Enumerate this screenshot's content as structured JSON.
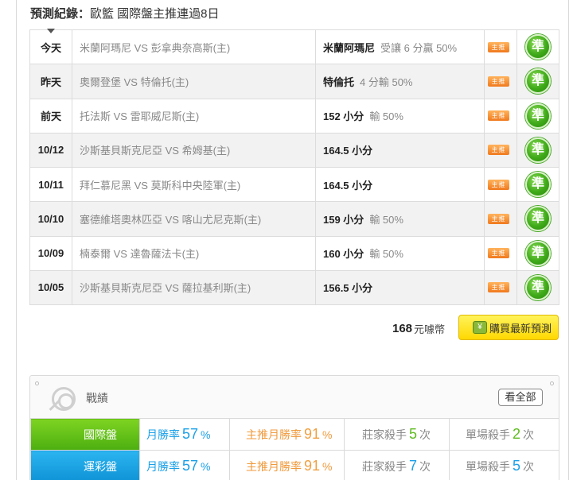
{
  "header": {
    "label": "預測紀錄：",
    "text": "歐籃 國際盤主推連過8日"
  },
  "picks": [
    {
      "date": "今天",
      "match": "米蘭阿瑪尼 VS 彭拿典奈高斯(主)",
      "pick": "米蘭阿瑪尼",
      "line": "受讓 6 分贏 50%",
      "tag": "主推",
      "result": "準"
    },
    {
      "date": "昨天",
      "match": "奧爾登堡 VS 特倫托(主)",
      "pick": "特倫托",
      "line": "4 分輸 50%",
      "tag": "主推",
      "result": "準"
    },
    {
      "date": "前天",
      "match": "托法斯 VS 雷耶威尼斯(主)",
      "pick": "152 小分",
      "line": "輸 50%",
      "tag": "主推",
      "result": "準"
    },
    {
      "date": "10/12",
      "match": "沙斯基貝斯克尼亞 VS 希姆基(主)",
      "pick": "164.5 小分",
      "line": "",
      "tag": "主推",
      "result": "準"
    },
    {
      "date": "10/11",
      "match": "拜仁慕尼黑 VS 莫斯科中央陸軍(主)",
      "pick": "164.5 小分",
      "line": "",
      "tag": "主推",
      "result": "準"
    },
    {
      "date": "10/10",
      "match": "塞德維塔奧林匹亞 VS 喀山尤尼克斯(主)",
      "pick": "159 小分",
      "line": "輸 50%",
      "tag": "主推",
      "result": "準"
    },
    {
      "date": "10/09",
      "match": "楠泰爾 VS 達魯薩法卡(主)",
      "pick": "160 小分",
      "line": "輸 50%",
      "tag": "主推",
      "result": "準"
    },
    {
      "date": "10/05",
      "match": "沙斯基貝斯克尼亞 VS 薩拉基利斯(主)",
      "pick": "156.5 小分",
      "line": "",
      "tag": "主推",
      "result": "準"
    }
  ],
  "price": {
    "amount": "168",
    "unit": "元噱幣"
  },
  "buy_button": {
    "label": "購買最新預測",
    "icon": "coin-bag-icon"
  },
  "stats": {
    "title": "戰績",
    "see_all": "看全部",
    "rows": [
      {
        "type": "國際盤",
        "color": "#5cbf15",
        "c1_label": "月勝率",
        "c1_value": "57",
        "c1_unit": "%",
        "c2_label": "主推月勝率",
        "c2_value": "91",
        "c2_unit": "%",
        "c3_label": "莊家殺手",
        "c3_value": "5",
        "c3_unit": "次",
        "c4_label": "單場殺手",
        "c4_value": "2",
        "c4_unit": "次"
      },
      {
        "type": "運彩盤",
        "color": "#1aa0e8",
        "c1_label": "月勝率",
        "c1_value": "57",
        "c1_unit": "%",
        "c2_label": "主推月勝率",
        "c2_value": "91",
        "c2_unit": "%",
        "c3_label": "莊家殺手",
        "c3_value": "7",
        "c3_unit": "次",
        "c4_label": "單場殺手",
        "c4_value": "5",
        "c4_unit": "次"
      }
    ]
  }
}
